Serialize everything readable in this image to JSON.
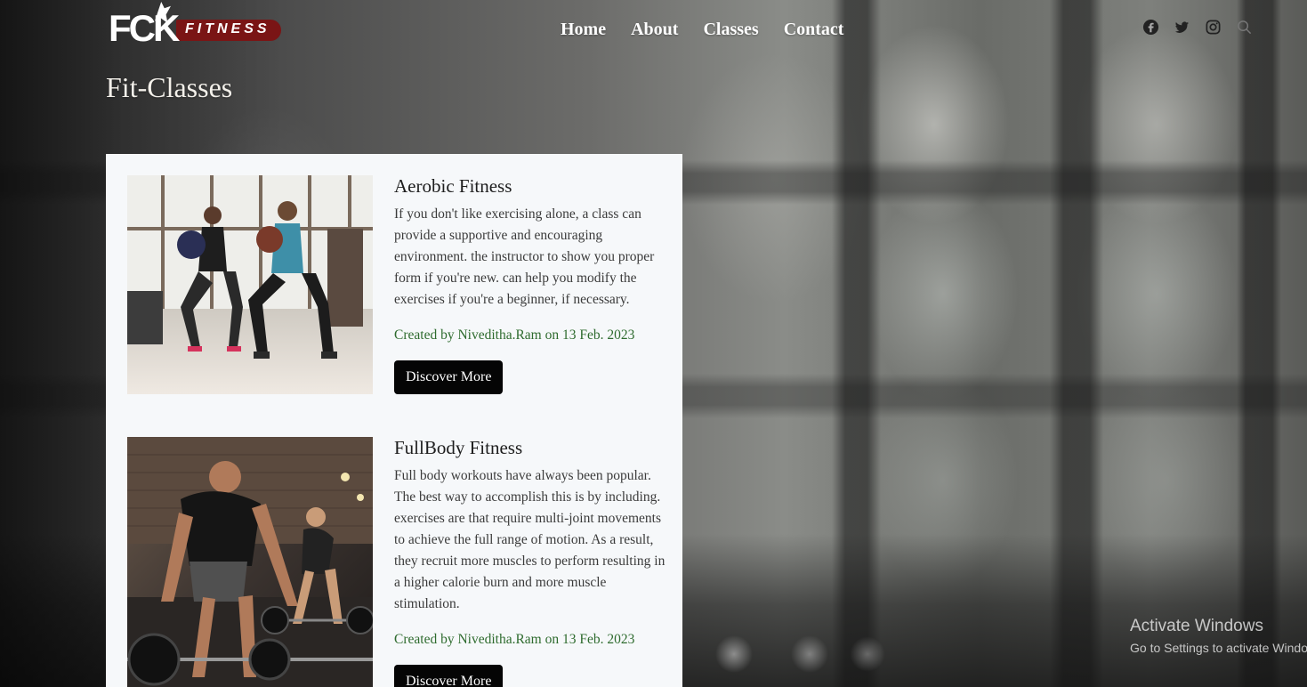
{
  "brand": {
    "logo_main": "FCK",
    "logo_sub": "FITNESS"
  },
  "nav": {
    "items": [
      "Home",
      "About",
      "Classes",
      "Contact"
    ]
  },
  "social": {
    "icons": [
      "facebook-icon",
      "twitter-icon",
      "instagram-icon",
      "search-icon"
    ]
  },
  "page": {
    "title": "Fit-Classes"
  },
  "classes": [
    {
      "title": "Aerobic Fitness",
      "description": "If you don't like exercising alone, a class can provide a supportive and encouraging environment. the instructor to show you proper form if you're new. can help you modify the exercises if you're a beginner, if necessary.",
      "meta": "Created by Niveditha.Ram on 13 Feb. 2023",
      "button": "Discover More"
    },
    {
      "title": "FullBody Fitness",
      "description": "Full body workouts have always been popular. The best way to accomplish this is by including. exercises are that require multi-joint movements to achieve the full range of motion. As a result, they recruit more muscles to perform resulting in a higher calorie burn and more muscle stimulation.",
      "meta": "Created by Niveditha.Ram on 13 Feb. 2023",
      "button": "Discover More"
    }
  ],
  "watermark": {
    "line1": "Activate Windows",
    "line2": "Go to Settings to activate Windows."
  },
  "colors": {
    "panel_bg": "#f6f8fa",
    "meta_green": "#2e6b2e",
    "button_bg": "#050505",
    "logo_red": "#7a1515"
  }
}
